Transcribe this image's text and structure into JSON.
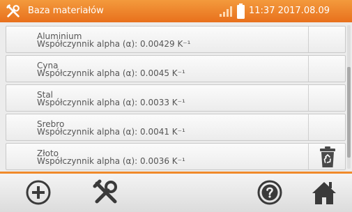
{
  "header": {
    "icon": "tools-icon",
    "title": "Baza materiałów",
    "signal_icon": "signal-bars-icon",
    "battery_icon": "battery-icon",
    "clock": "11:37 2017.08.09"
  },
  "materials": [
    {
      "name": "Aluminium",
      "coefficient": "Współczynnik alpha (α): 0.00429 K⁻¹"
    },
    {
      "name": "Cyna",
      "coefficient": "Współczynnik alpha (α): 0.0045 K⁻¹"
    },
    {
      "name": "Stal",
      "coefficient": "Współczynnik alpha (α): 0.0033 K⁻¹"
    },
    {
      "name": "Srebro",
      "coefficient": "Współczynnik alpha (α): 0.0041 K⁻¹"
    },
    {
      "name": "Złoto",
      "coefficient": "Współczynnik alpha (α): 0.0036 K⁻¹"
    }
  ],
  "delete_icon": "recycle-bin-icon",
  "toolbar": {
    "buttons": [
      "plus-circle-icon",
      "tools-icon",
      "help-icon",
      "home-icon"
    ]
  },
  "colors": {
    "accent": "#e8701c",
    "header_text": "#ffffff",
    "toolbar_icon": "#3a3a3a"
  }
}
